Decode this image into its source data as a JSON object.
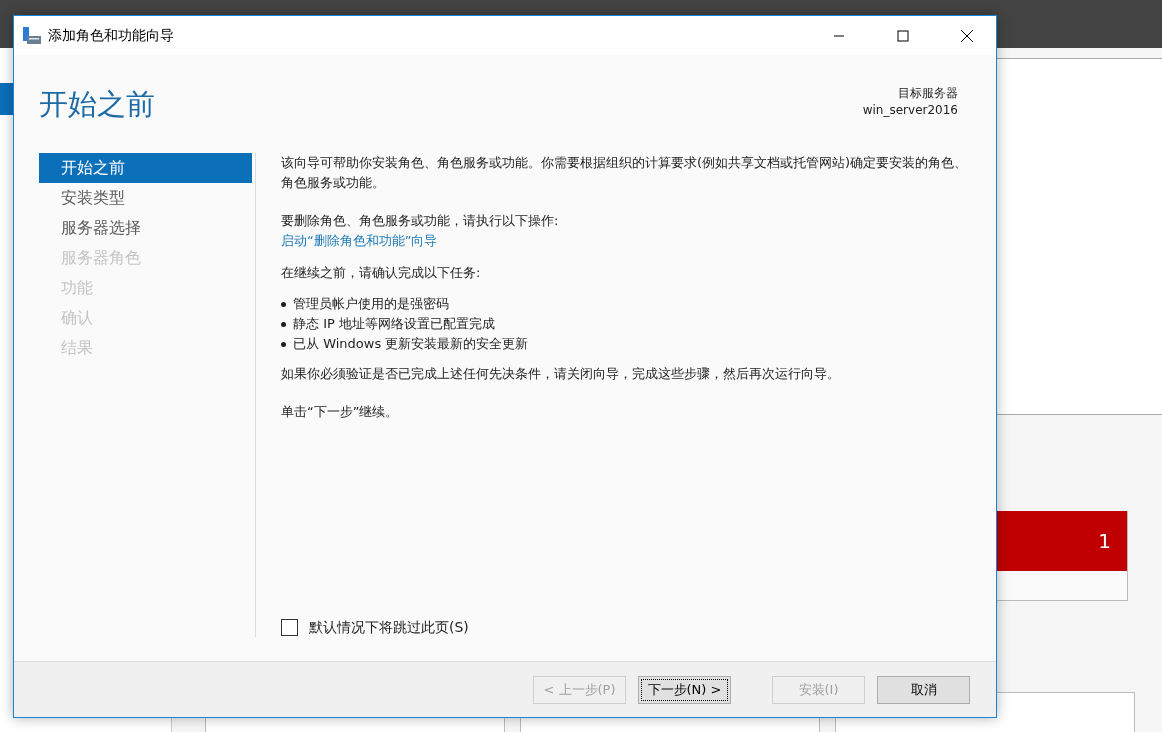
{
  "background": {
    "tile_count": "1"
  },
  "window": {
    "title": "添加角色和功能向导"
  },
  "header": {
    "title": "开始之前",
    "target_label": "目标服务器",
    "target_value": "win_server2016"
  },
  "steps": [
    {
      "label": "开始之前",
      "selected": true,
      "disabled": false
    },
    {
      "label": "安装类型",
      "selected": false,
      "disabled": false
    },
    {
      "label": "服务器选择",
      "selected": false,
      "disabled": false
    },
    {
      "label": "服务器角色",
      "selected": false,
      "disabled": true
    },
    {
      "label": "功能",
      "selected": false,
      "disabled": true
    },
    {
      "label": "确认",
      "selected": false,
      "disabled": true
    },
    {
      "label": "结果",
      "selected": false,
      "disabled": true
    }
  ],
  "content": {
    "intro": "该向导可帮助你安装角色、角色服务或功能。你需要根据组织的计算要求(例如共享文档或托管网站)确定要安装的角色、角色服务或功能。",
    "remove_text": "要删除角色、角色服务或功能，请执行以下操作:",
    "remove_link": "启动“删除角色和功能”向导",
    "before_text": "在继续之前，请确认完成以下任务:",
    "tasks": [
      "管理员帐户使用的是强密码",
      "静态 IP 地址等网络设置已配置完成",
      "已从 Windows 更新安装最新的安全更新"
    ],
    "verify_text": "如果你必须验证是否已完成上述任何先决条件，请关闭向导，完成这些步骤，然后再次运行向导。",
    "next_text": "单击“下一步”继续。"
  },
  "skip_checkbox": {
    "label": "默认情况下将跳过此页(S)",
    "checked": false
  },
  "buttons": [
    {
      "label": "< 上一步(P)",
      "disabled": true,
      "focused": false
    },
    {
      "label": "下一步(N) >",
      "disabled": false,
      "focused": true
    },
    {
      "label": "安装(I)",
      "disabled": true,
      "focused": false
    },
    {
      "label": "取消",
      "disabled": false,
      "focused": false
    }
  ]
}
